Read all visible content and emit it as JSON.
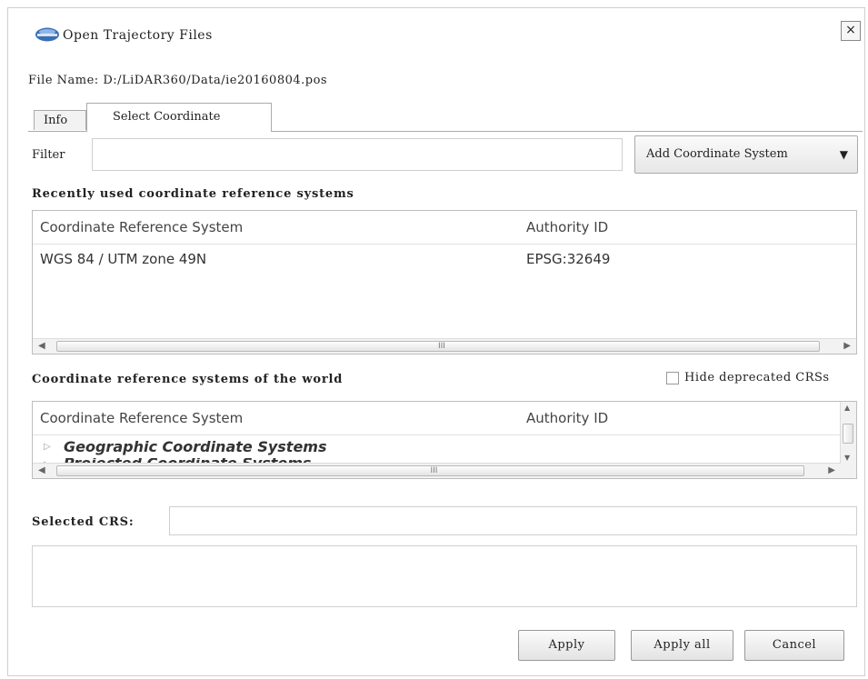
{
  "window": {
    "title": "Open Trajectory Files",
    "close_label": "×",
    "app_icon": "lidar360-logo-icon"
  },
  "file_name": "File Name: D:/LiDAR360/Data/ie20160804.pos",
  "tabs": [
    {
      "label": "Info",
      "active": false
    },
    {
      "label": "Select Coordinate",
      "active": true
    }
  ],
  "filter": {
    "label": "Filter",
    "value": "",
    "placeholder": ""
  },
  "add_crs_button": {
    "label": "Add Coordinate System",
    "arrow": "▼"
  },
  "recent": {
    "heading": "Recently used coordinate reference systems",
    "columns": [
      "Coordinate Reference System",
      "Authority ID"
    ],
    "rows": [
      {
        "crs": "WGS 84 / UTM zone 49N",
        "authority": "EPSG:32649"
      }
    ]
  },
  "world": {
    "heading": "Coordinate reference systems of the world",
    "hide_deprecated_label": "Hide deprecated CRSs",
    "hide_deprecated_checked": false,
    "columns": [
      "Coordinate Reference System",
      "Authority ID"
    ],
    "rows": [
      {
        "label": "Geographic Coordinate Systems",
        "expanded": false
      },
      {
        "label": "Projected Coordinate Systems",
        "expanded": false
      }
    ]
  },
  "selected_crs": {
    "label": "Selected CRS:",
    "value": ""
  },
  "buttons": {
    "apply": "Apply",
    "apply_all": "Apply all",
    "cancel": "Cancel"
  },
  "colors": {
    "border": "#bdbdbd",
    "button_top": "#fbfbfb",
    "button_bottom": "#e3e3e3"
  }
}
